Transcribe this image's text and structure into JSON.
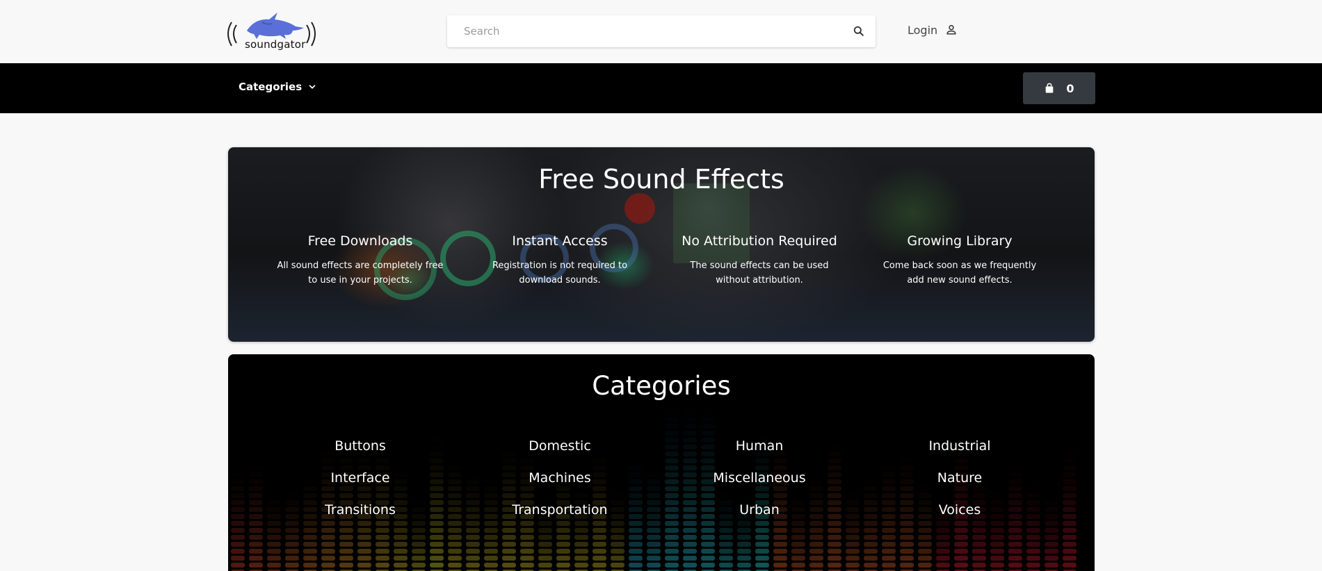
{
  "header": {
    "logo_text": "soundgator",
    "search_placeholder": "Search",
    "login_label": "Login"
  },
  "nav": {
    "categories_label": "Categories",
    "cart_count": "0"
  },
  "hero": {
    "title": "Free Sound Effects",
    "features": [
      {
        "title": "Free Downloads",
        "text": "All sound effects are completely free to use in your projects."
      },
      {
        "title": "Instant Access",
        "text": "Registration is not required to download sounds."
      },
      {
        "title": "No Attribution Required",
        "text": "The sound effects can be used without attribution."
      },
      {
        "title": "Growing Library",
        "text": "Come back soon as we frequently add new sound effects."
      }
    ]
  },
  "categories": {
    "title": "Categories",
    "items": [
      "Buttons",
      "Domestic",
      "Human",
      "Industrial",
      "Interface",
      "Machines",
      "Miscellaneous",
      "Nature",
      "Transitions",
      "Transportation",
      "Urban",
      "Voices"
    ]
  },
  "colors": {
    "nav_bg": "#000000",
    "cart_bg": "#343a40",
    "logo_blue": "#5a6fd8",
    "page_bg": "#f8f8f8"
  },
  "icons": {
    "search": "search-icon",
    "login": "user-icon",
    "dropdown": "chevron-down-icon",
    "cart": "shopping-bag-icon"
  }
}
